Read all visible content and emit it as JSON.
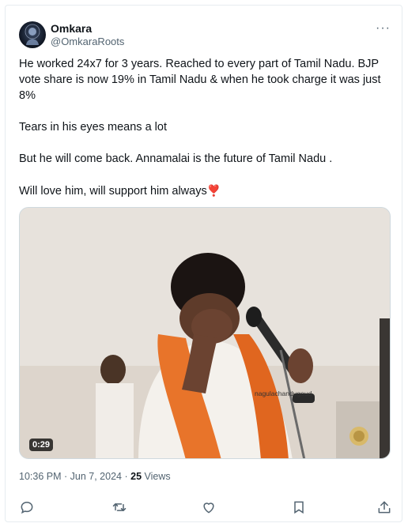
{
  "author": {
    "name": "Omkara",
    "handle": "@OmkaraRoots"
  },
  "more_label": "···",
  "tweet": {
    "lines": [
      "He worked 24x7 for 3 years. Reached to every part of Tamil Nadu. BJP vote share is now 19% in Tamil Nadu & when he took charge it was just 8%",
      "Tears in his eyes means a lot",
      "But he will come back. Annamalai is the future of Tamil Nadu .",
      "Will love him, will support him always"
    ],
    "emoji": "❣️"
  },
  "media": {
    "duration": "0:29",
    "watermark": "nagulachandugoud"
  },
  "meta": {
    "time": "10:36 PM",
    "date": "Jun 7, 2024",
    "separator": "·",
    "views_count": "25",
    "views_label": "Views"
  },
  "icons": {
    "reply": "reply-icon",
    "retweet": "retweet-icon",
    "like": "like-icon",
    "bookmark": "bookmark-icon",
    "share": "share-icon"
  }
}
